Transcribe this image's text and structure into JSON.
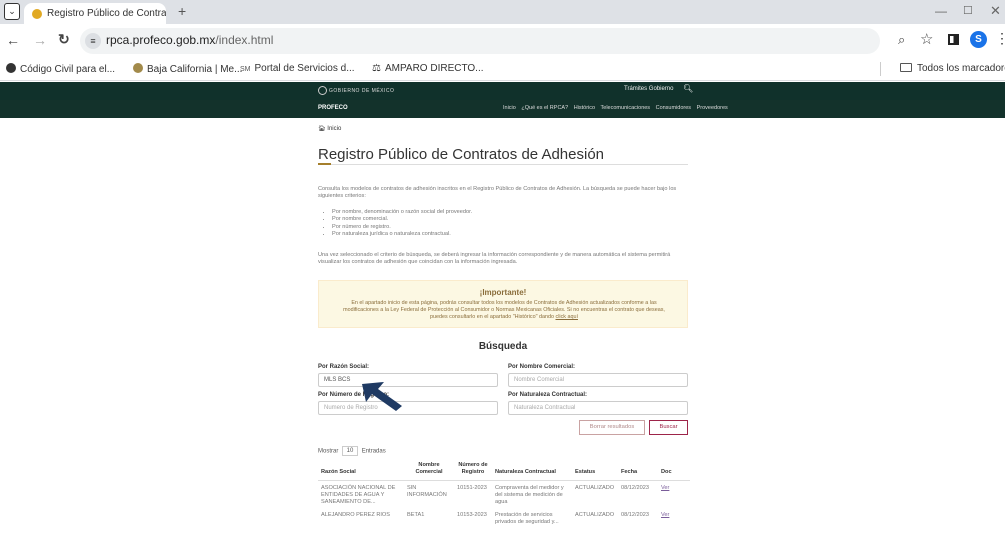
{
  "browser": {
    "tab_title": "Registro Público de Contratos d",
    "url_domain": "rpca.profeco.gob.mx",
    "url_path": "/index.html",
    "profile_initial": "S",
    "bookmarks": [
      {
        "label": "Código Civil para el...",
        "icon": "globe-icon"
      },
      {
        "label": "Baja California | Me...",
        "icon": "seal-icon"
      },
      {
        "label": "Portal de Servicios d...",
        "icon": "sm-icon"
      },
      {
        "label": "AMPARO DIRECTO...",
        "icon": "scales-icon"
      }
    ],
    "bookmarks_folder": "Todos los marcadores"
  },
  "site": {
    "gov_logo": "GOBIERNO DE MÉXICO",
    "gov_links": "Trámites   Gobierno",
    "brand": "PROFECO",
    "nav": [
      "Inicio",
      "¿Qué es el RPCA?",
      "Histórico",
      "Telecomunicaciones",
      "Consumidores",
      "Proveedores"
    ]
  },
  "page": {
    "breadcrumb": "Inicio",
    "title": "Registro Público de Contratos de Adhesión",
    "intro": "Consulta los modelos de contratos de adhesión inscritos en el Registro Público de Contratos de Adhesión. La búsqueda se puede hacer bajo los siguientes criterios:",
    "criteria": [
      "Por nombre, denominación o razón social del proveedor.",
      "Por nombre comercial.",
      "Por número de registro.",
      "Por naturaleza jurídica o naturaleza contractual."
    ],
    "after": "Una vez seleccionado el criterio de búsqueda, se deberá ingresar la información correspondiente y de manera automática el sistema permitirá visualizar los contratos de adhesión que coincidan con la información ingresada.",
    "notice_title": "¡Importante!",
    "notice_body": "En el apartado inicio de esta página, podrás consultar todos los modelos de Contratos de Adhesión actualizados conforme a las modificaciones a la Ley Federal de Protección al Consumidor o Normas Mexicanas Oficiales. Si no encuentras el contrato que deseas, puedes consultarlo en el apartado \"Histórico\" dando ",
    "notice_link": "click aquí",
    "search_heading": "Búsqueda"
  },
  "form": {
    "razon_label": "Por Razón Social:",
    "razon_value": "MLS BCS",
    "comercial_label": "Por Nombre Comercial:",
    "comercial_placeholder": "Nombre Comercial",
    "registro_label": "Por Número de Registro:",
    "registro_placeholder": "Numero de Registro",
    "naturaleza_label": "Por Naturaleza Contractual:",
    "naturaleza_placeholder": "Naturaleza Contractual",
    "clear_label": "Borrar resultados",
    "search_label": "Buscar"
  },
  "table": {
    "show_prefix": "Mostrar",
    "show_value": "10",
    "show_suffix": "Entradas",
    "headers": [
      "Razón Social",
      "Nombre Comercial",
      "Número de Registro",
      "Naturaleza Contractual",
      "Estatus",
      "Fecha",
      "Doc"
    ],
    "rows": [
      {
        "razon": "ASOCIACIÓN NACIONAL DE ENTIDADES DE AGUA Y SANEAMIENTO DE...",
        "comercial": "SIN INFORMACIÓN",
        "registro": "10151-2023",
        "naturaleza": "Compraventa del medidor y del sistema de medición de agua",
        "estatus": "ACTUALIZADO",
        "fecha": "08/12/2023",
        "doc": "Ver"
      },
      {
        "razon": "ALEJANDRO PEREZ RIOS",
        "comercial": "BETA1",
        "registro": "10153-2023",
        "naturaleza": "Prestación de servicios privados de seguridad y...",
        "estatus": "ACTUALIZADO",
        "fecha": "08/12/2023",
        "doc": "Ver"
      }
    ]
  }
}
